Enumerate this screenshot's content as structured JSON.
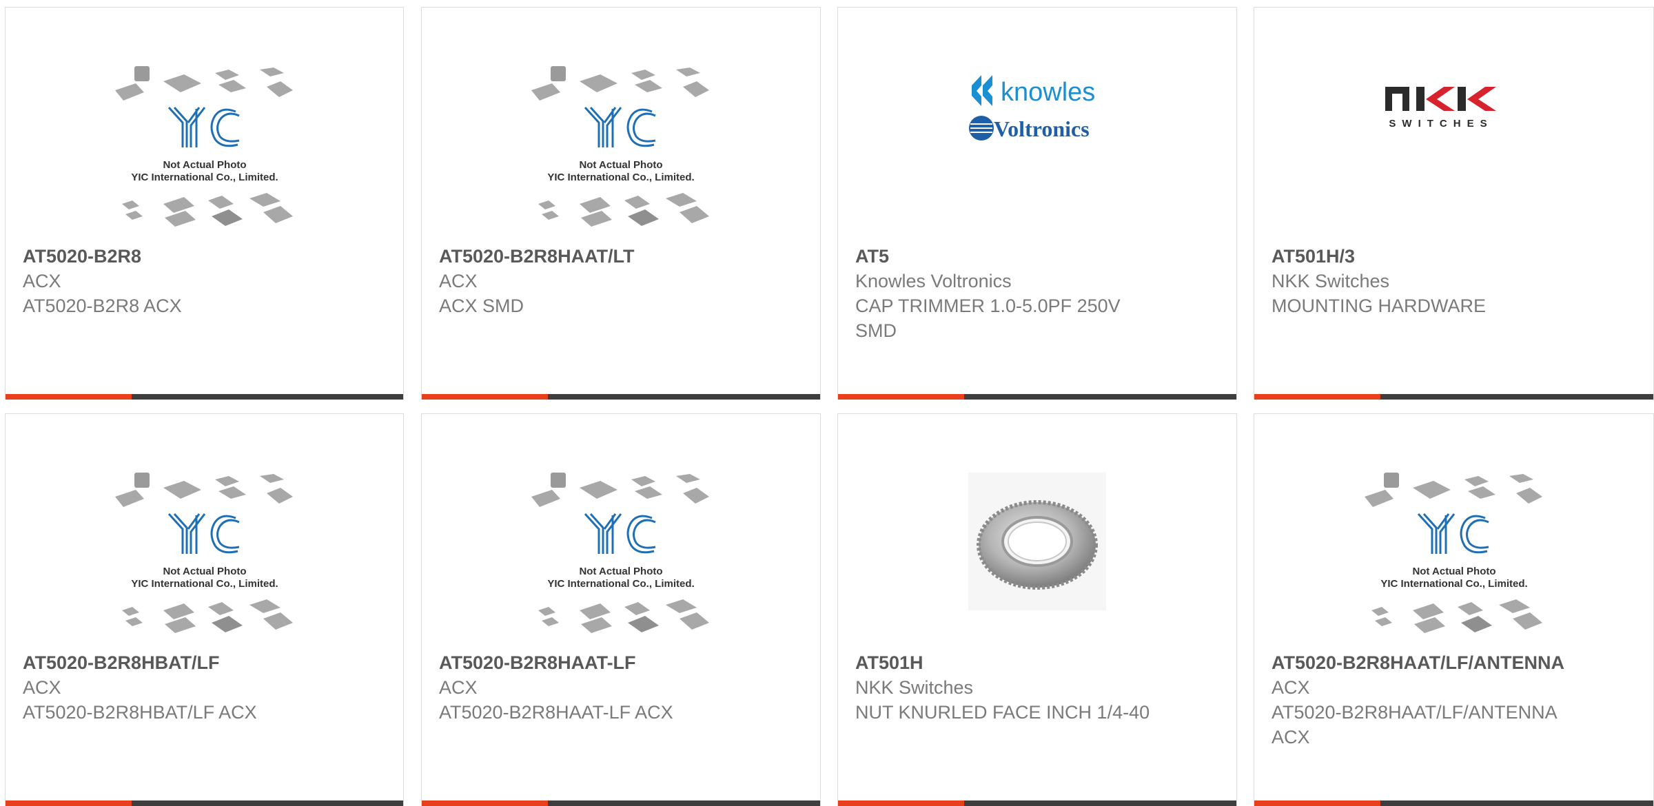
{
  "products": [
    {
      "part_number": "AT5020-B2R8",
      "manufacturer": "ACX",
      "description": "AT5020-B2R8 ACX",
      "image": "yic-placeholder",
      "image_caption": [
        "Not Actual Photo",
        "YIC International Co., Limited."
      ]
    },
    {
      "part_number": "AT5020-B2R8HAAT/LT",
      "manufacturer": "ACX",
      "description": "ACX SMD",
      "image": "yic-placeholder",
      "image_caption": [
        "Not Actual Photo",
        "YIC International Co., Limited."
      ]
    },
    {
      "part_number": "AT5",
      "manufacturer": "Knowles Voltronics",
      "description": "CAP TRIMMER 1.0-5.0PF 250V SMD",
      "image": "knowles-voltronics-logo",
      "logo_text": [
        "knowles",
        "Voltronics"
      ]
    },
    {
      "part_number": "AT501H/3",
      "manufacturer": "NKK Switches",
      "description": "MOUNTING HARDWARE",
      "image": "nkk-switches-logo",
      "logo_text": [
        "NKK",
        "SWITCHES"
      ]
    },
    {
      "part_number": "AT5020-B2R8HBAT/LF",
      "manufacturer": "ACX",
      "description": "AT5020-B2R8HBAT/LF ACX",
      "image": "yic-placeholder",
      "image_caption": [
        "Not Actual Photo",
        "YIC International Co., Limited."
      ]
    },
    {
      "part_number": "AT5020-B2R8HAAT-LF",
      "manufacturer": "ACX",
      "description": "AT5020-B2R8HAAT-LF ACX",
      "image": "yic-placeholder",
      "image_caption": [
        "Not Actual Photo",
        "YIC International Co., Limited."
      ]
    },
    {
      "part_number": "AT501H",
      "manufacturer": "NKK Switches",
      "description": "NUT KNURLED FACE INCH 1/4-40",
      "image": "knurled-nut-photo"
    },
    {
      "part_number": "AT5020-B2R8HAAT/LF/ANTENNA",
      "manufacturer": "ACX",
      "description": "AT5020-B2R8HAAT/LF/ANTENNA ACX",
      "image": "yic-placeholder",
      "image_caption": [
        "Not Actual Photo",
        "YIC International Co., Limited."
      ]
    }
  ],
  "colors": {
    "accent": "#e8401c",
    "bar": "#3e3e3e",
    "yic_blue": "#1f6fb5",
    "knowles_blue": "#1a8fd1",
    "nkk_red": "#d7232d"
  }
}
